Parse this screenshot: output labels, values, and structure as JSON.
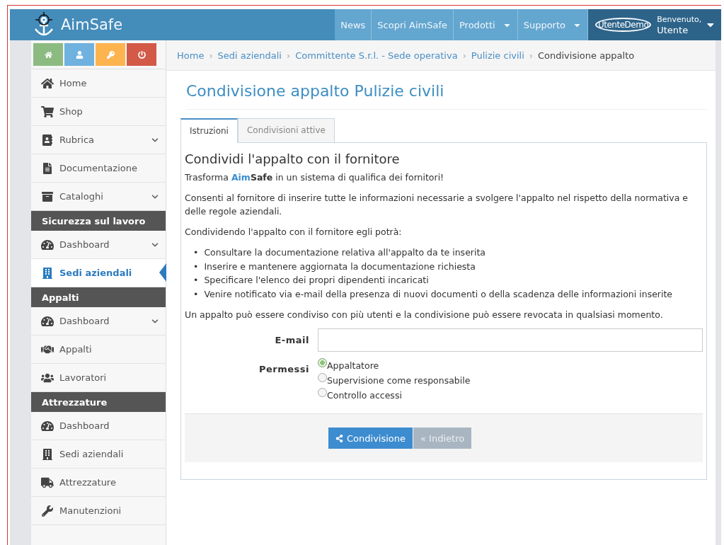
{
  "header": {
    "brand": "AimSafe",
    "nav": [
      {
        "label": "News",
        "dropdown": false
      },
      {
        "label": "Scopri AimSafe",
        "dropdown": false
      },
      {
        "label": "Prodotti",
        "dropdown": true
      },
      {
        "label": "Supporto",
        "dropdown": true
      }
    ],
    "user": {
      "username": "UtenteDemo",
      "greeting": "Benvenuto,",
      "name": "Utente"
    }
  },
  "sidebar": {
    "items": [
      {
        "kind": "item",
        "label": "Home",
        "expandable": false,
        "selected": false
      },
      {
        "kind": "item",
        "label": "Shop",
        "expandable": false,
        "selected": false
      },
      {
        "kind": "item",
        "label": "Rubrica",
        "expandable": true,
        "selected": false
      },
      {
        "kind": "item",
        "label": "Documentazione",
        "expandable": false,
        "selected": false
      },
      {
        "kind": "item",
        "label": "Cataloghi",
        "expandable": true,
        "selected": false
      },
      {
        "kind": "section",
        "label": "Sicurezza sul lavoro"
      },
      {
        "kind": "item",
        "label": "Dashboard",
        "expandable": true,
        "selected": false
      },
      {
        "kind": "item",
        "label": "Sedi aziendali",
        "expandable": false,
        "selected": true
      },
      {
        "kind": "section",
        "label": "Appalti"
      },
      {
        "kind": "item",
        "label": "Dashboard",
        "expandable": true,
        "selected": false
      },
      {
        "kind": "item",
        "label": "Appalti",
        "expandable": false,
        "selected": false
      },
      {
        "kind": "item",
        "label": "Lavoratori",
        "expandable": false,
        "selected": false
      },
      {
        "kind": "section",
        "label": "Attrezzature"
      },
      {
        "kind": "item",
        "label": "Dashboard",
        "expandable": false,
        "selected": false
      },
      {
        "kind": "item",
        "label": "Sedi aziendali",
        "expandable": false,
        "selected": false
      },
      {
        "kind": "item",
        "label": "Attrezzature",
        "expandable": false,
        "selected": false
      },
      {
        "kind": "item",
        "label": "Manutenzioni",
        "expandable": false,
        "selected": false
      }
    ]
  },
  "breadcrumb": {
    "separator": "›",
    "items": [
      "Home",
      "Sedi aziendali",
      "Committente S.r.l. - Sede operativa",
      "Pulizie civili",
      "Condivisione appalto"
    ]
  },
  "page_title": "Condivisione appalto Pulizie civili",
  "tabs": [
    {
      "label": "Istruzioni",
      "selected": true
    },
    {
      "label": "Condivisioni attive",
      "selected": false
    }
  ],
  "panel": {
    "heading": "Condividi l'appalto con il fornitore",
    "intro": {
      "before": "Trasforma ",
      "brand_accent": "Aim",
      "brand_rest": "Safe",
      "after": " in un sistema di qualifica dei fornitori!"
    },
    "bullet_marker": "•",
    "paragraphs": [
      "Consenti al fornitore di inserire tutte le informazioni necessarie a svolgere l'appalto nel rispetto della normativa e delle regole aziendali.",
      "Condividendo l'appalto con il fornitore egli potrà:"
    ],
    "bullets": [
      "Consultare la documentazione relativa all'appalto da te inserita",
      "Inserire e mantenere aggiornata la documentazione richiesta",
      "Specificare l'elenco dei propri dipendenti incaricati",
      "Venire notificato via e-mail della presenza di nuovi documenti o della scadenza delle informazioni inserite"
    ],
    "note": "Un appalto può essere condiviso con più utenti e la condivisione può essere revocata in qualsiasi momento.",
    "email_label": "E-mail",
    "permissions_label": "Permessi",
    "permissions": [
      {
        "label": "Appaltatore",
        "selected": true
      },
      {
        "label": "Supervisione come responsabile",
        "selected": false
      },
      {
        "label": "Controllo accessi",
        "selected": false
      }
    ],
    "buttons": [
      {
        "label": "Condivisione",
        "kind": "primary"
      },
      {
        "label": "« Indietro",
        "kind": "secondary"
      }
    ]
  }
}
